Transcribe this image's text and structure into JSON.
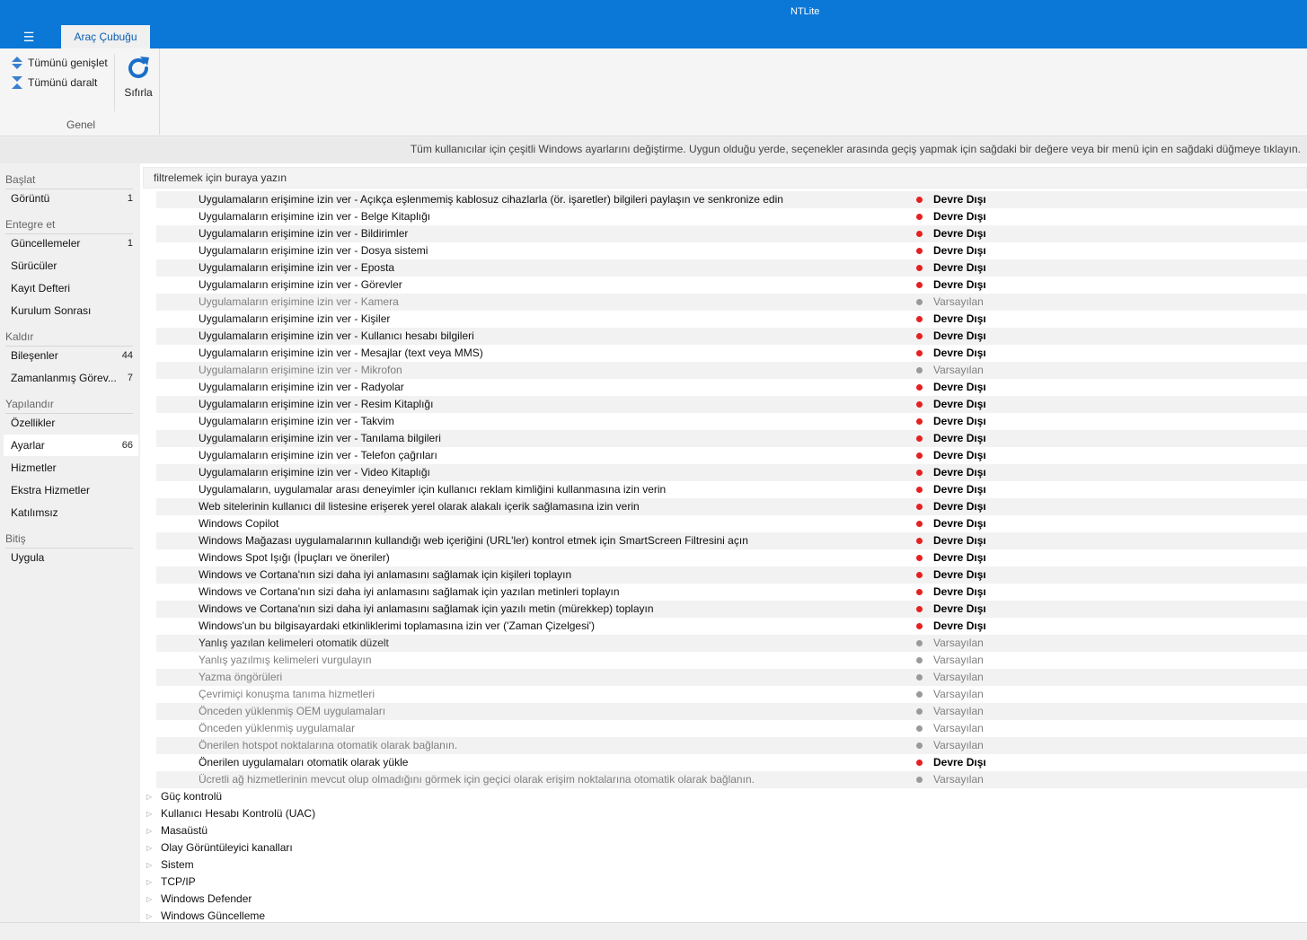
{
  "app": {
    "title": "NTLite",
    "menu_icon": "hamburger-icon"
  },
  "ribbon": {
    "tab_label": "Araç Çubuğu",
    "expand_all": "Tümünü genişlet",
    "collapse_all": "Tümünü daralt",
    "reset": "Sıfırla",
    "group_label": "Genel"
  },
  "info": "Tüm kullanıcılar için çeşitli Windows ayarlarını değiştirme. Uygun olduğu yerde, seçenekler arasında geçiş yapmak için sağdaki bir değere veya bir menü için en sağdaki düğmeye tıklayın.",
  "sidebar": {
    "sections": [
      {
        "label": "Başlat"
      },
      {
        "label": "Entegre et"
      },
      {
        "label": "Kaldır"
      },
      {
        "label": "Yapılandır"
      },
      {
        "label": "Bitiş"
      }
    ],
    "items": [
      {
        "label": "Görüntü",
        "count": "1"
      },
      {
        "label": "Güncellemeler",
        "count": "1"
      },
      {
        "label": "Sürücüler",
        "count": ""
      },
      {
        "label": "Kayıt Defteri",
        "count": ""
      },
      {
        "label": "Kurulum Sonrası",
        "count": ""
      },
      {
        "label": "Bileşenler",
        "count": "44"
      },
      {
        "label": "Zamanlanmış Görev...",
        "count": "7"
      },
      {
        "label": "Özellikler",
        "count": ""
      },
      {
        "label": "Ayarlar",
        "count": "66"
      },
      {
        "label": "Hizmetler",
        "count": ""
      },
      {
        "label": "Ekstra Hizmetler",
        "count": ""
      },
      {
        "label": "Katılımsız",
        "count": ""
      },
      {
        "label": "Uygula",
        "count": ""
      }
    ]
  },
  "filter_placeholder": "filtrelemek için buraya yazın",
  "settings": [
    {
      "name": "Uygulamaların erişimine izin ver - Açıkça eşlenmemiş kablosuz cihazlarla (ör. işaretler) bilgileri paylaşın ve senkronize edin",
      "value": "Devre Dışı"
    },
    {
      "name": "Uygulamaların erişimine izin ver - Belge Kitaplığı",
      "value": "Devre Dışı"
    },
    {
      "name": "Uygulamaların erişimine izin ver - Bildirimler",
      "value": "Devre Dışı"
    },
    {
      "name": "Uygulamaların erişimine izin ver - Dosya sistemi",
      "value": "Devre Dışı"
    },
    {
      "name": "Uygulamaların erişimine izin ver - Eposta",
      "value": "Devre Dışı"
    },
    {
      "name": "Uygulamaların erişimine izin ver - Görevler",
      "value": "Devre Dışı"
    },
    {
      "name": "Uygulamaların erişimine izin ver - Kamera",
      "value": "Varsayılan"
    },
    {
      "name": "Uygulamaların erişimine izin ver - Kişiler",
      "value": "Devre Dışı"
    },
    {
      "name": "Uygulamaların erişimine izin ver - Kullanıcı hesabı bilgileri",
      "value": "Devre Dışı"
    },
    {
      "name": "Uygulamaların erişimine izin ver - Mesajlar (text veya MMS)",
      "value": "Devre Dışı"
    },
    {
      "name": "Uygulamaların erişimine izin ver - Mikrofon",
      "value": "Varsayılan"
    },
    {
      "name": "Uygulamaların erişimine izin ver - Radyolar",
      "value": "Devre Dışı"
    },
    {
      "name": "Uygulamaların erişimine izin ver - Resim Kitaplığı",
      "value": "Devre Dışı"
    },
    {
      "name": "Uygulamaların erişimine izin ver - Takvim",
      "value": "Devre Dışı"
    },
    {
      "name": "Uygulamaların erişimine izin ver - Tanılama bilgileri",
      "value": "Devre Dışı"
    },
    {
      "name": "Uygulamaların erişimine izin ver - Telefon çağrıları",
      "value": "Devre Dışı"
    },
    {
      "name": "Uygulamaların erişimine izin ver - Video Kitaplığı",
      "value": "Devre Dışı"
    },
    {
      "name": "Uygulamaların, uygulamalar arası deneyimler için kullanıcı reklam kimliğini kullanmasına izin verin",
      "value": "Devre Dışı"
    },
    {
      "name": "Web sitelerinin kullanıcı dil listesine erişerek yerel olarak alakalı içerik sağlamasına izin verin",
      "value": "Devre Dışı"
    },
    {
      "name": "Windows Copilot",
      "value": "Devre Dışı"
    },
    {
      "name": "Windows Mağazası uygulamalarının kullandığı web içeriğini (URL'ler) kontrol etmek için SmartScreen Filtresini açın",
      "value": "Devre Dışı"
    },
    {
      "name": "Windows Spot Işığı (İpuçları ve öneriler)",
      "value": "Devre Dışı"
    },
    {
      "name": "Windows ve Cortana'nın sizi daha iyi anlamasını sağlamak için kişileri toplayın",
      "value": "Devre Dışı"
    },
    {
      "name": "Windows ve Cortana'nın sizi daha iyi anlamasını sağlamak için yazılan metinleri toplayın",
      "value": "Devre Dışı"
    },
    {
      "name": "Windows ve Cortana'nın sizi daha iyi anlamasını sağlamak için yazılı metin (mürekkep) toplayın",
      "value": "Devre Dışı"
    },
    {
      "name": "Windows'un bu bilgisayardaki etkinliklerimi toplamasına izin ver ('Zaman Çizelgesi')",
      "value": "Devre Dışı"
    },
    {
      "name": "Yanlış yazılan kelimeleri otomatik düzelt",
      "value": "Varsayılan",
      "name_dark": true
    },
    {
      "name": "Yanlış yazılmış kelimeleri vurgulayın",
      "value": "Varsayılan"
    },
    {
      "name": "Yazma öngörüleri",
      "value": "Varsayılan"
    },
    {
      "name": "Çevrimiçi konuşma tanıma hizmetleri",
      "value": "Varsayılan"
    },
    {
      "name": "Önceden yüklenmiş OEM uygulamaları",
      "value": "Varsayılan"
    },
    {
      "name": "Önceden yüklenmiş uygulamalar",
      "value": "Varsayılan"
    },
    {
      "name": "Önerilen hotspot noktalarına otomatik olarak bağlanın.",
      "value": "Varsayılan"
    },
    {
      "name": "Önerilen uygulamaları otomatik olarak yükle",
      "value": "Devre Dışı"
    },
    {
      "name": "Ücretli ağ hizmetlerinin mevcut olup olmadığını görmek için geçici olarak erişim noktalarına otomatik olarak bağlanın.",
      "value": "Varsayılan"
    }
  ],
  "categories": [
    "Güç kontrolü",
    "Kullanıcı Hesabı Kontrolü (UAC)",
    "Masaüstü",
    "Olay Görüntüleyici kanalları",
    "Sistem",
    "TCP/IP",
    "Windows Defender",
    "Windows Güncelleme"
  ],
  "colors": {
    "accent": "#0b77d6",
    "disabled_dot": "#e62020",
    "default_dot": "#9a9a9a"
  }
}
